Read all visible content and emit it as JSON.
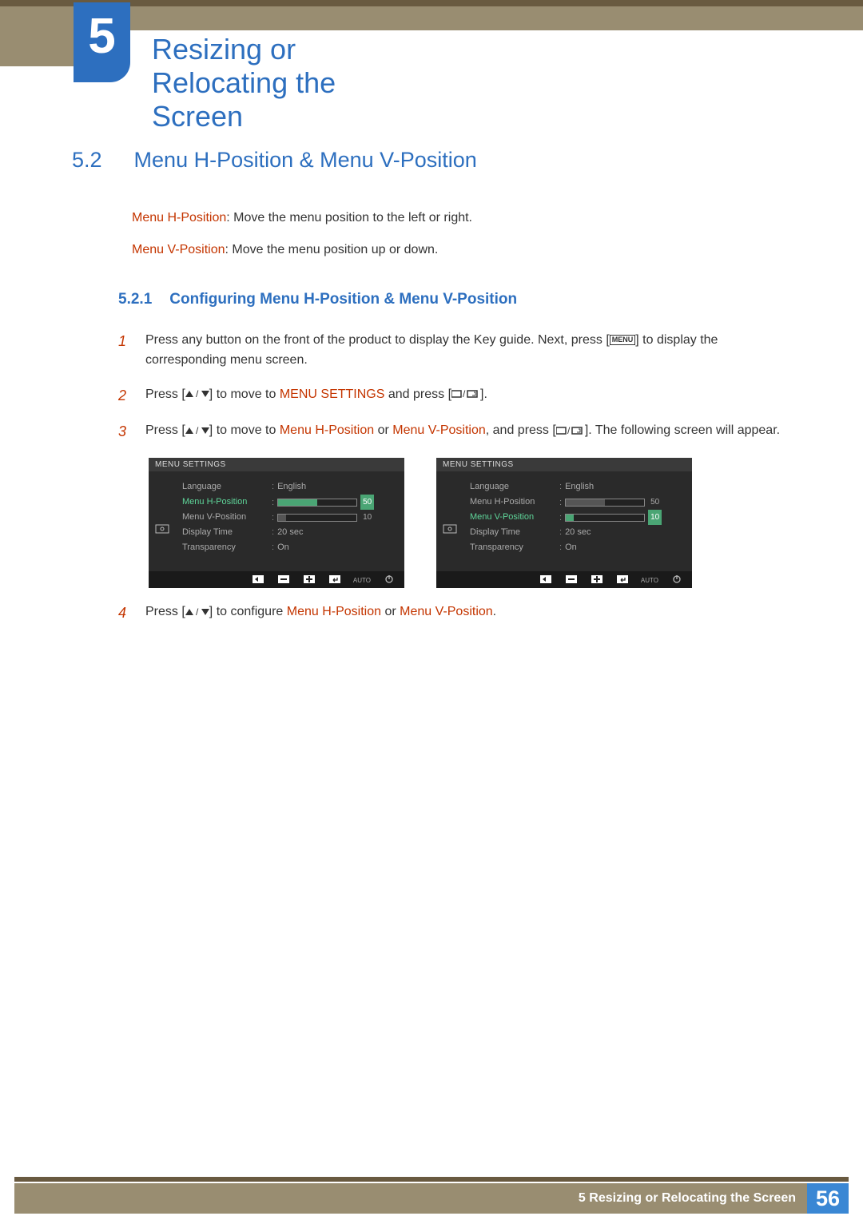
{
  "chapter": {
    "number": "5",
    "title": "Resizing or Relocating the Screen"
  },
  "section": {
    "number": "5.2",
    "title": "Menu H-Position & Menu V-Position"
  },
  "desc": {
    "h_label": "Menu H-Position",
    "h_text": ": Move the menu position to the left or right.",
    "v_label": "Menu V-Position",
    "v_text": ": Move the menu position up or down."
  },
  "subsection": {
    "number": "5.2.1",
    "title": "Configuring Menu H-Position & Menu V-Position"
  },
  "steps": {
    "s1a": "Press any button on the front of the product to display the Key guide. Next, press [",
    "s1_menu": "MENU",
    "s1b": "] to display the corresponding menu screen.",
    "s2a": "Press [",
    "s2b": "] to move to ",
    "s2_target": "MENU SETTINGS",
    "s2c": " and press [",
    "s2d": "].",
    "s3a": "Press [",
    "s3b": "] to move to ",
    "s3_h": "Menu H-Position",
    "s3_or": " or ",
    "s3_v": "Menu V-Position",
    "s3c": ", and press [",
    "s3d": "]. The following screen will appear.",
    "s4a": "Press [",
    "s4b": "] to configure ",
    "s4_h": "Menu H-Position",
    "s4_or": " or ",
    "s4_v": "Menu V-Position",
    "s4c": "."
  },
  "osd": {
    "header": "MENU SETTINGS",
    "labels": {
      "language": "Language",
      "hpos": "Menu H-Position",
      "vpos": "Menu V-Position",
      "display_time": "Display Time",
      "transparency": "Transparency"
    },
    "values": {
      "language": "English",
      "hpos": "50",
      "vpos": "10",
      "display_time": "20 sec",
      "transparency": "On"
    },
    "footer": {
      "auto": "AUTO"
    }
  },
  "footer": {
    "text": "5 Resizing or Relocating the Screen",
    "page": "56"
  }
}
